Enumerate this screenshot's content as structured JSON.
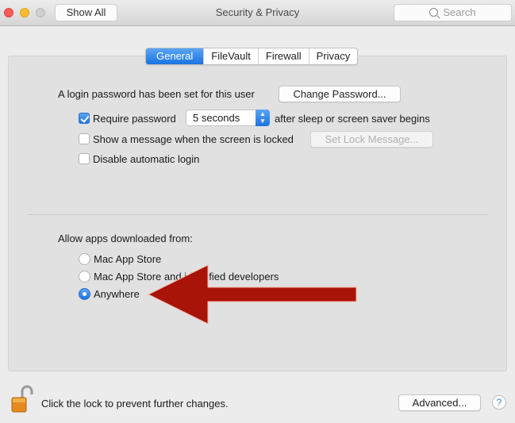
{
  "window": {
    "title": "Security & Privacy",
    "show_all_label": "Show All",
    "search_placeholder": "Search"
  },
  "tabs": [
    {
      "label": "General",
      "active": true
    },
    {
      "label": "FileVault",
      "active": false
    },
    {
      "label": "Firewall",
      "active": false
    },
    {
      "label": "Privacy",
      "active": false
    }
  ],
  "general": {
    "login_password_text": "A login password has been set for this user",
    "change_password_label": "Change Password...",
    "require_password": {
      "label": "Require password",
      "checked": true
    },
    "require_password_delay": "5 seconds",
    "after_sleep_text": "after sleep or screen saver begins",
    "show_message": {
      "label": "Show a message when the screen is locked",
      "checked": false
    },
    "set_lock_message_label": "Set Lock Message...",
    "disable_auto_login": {
      "label": "Disable automatic login",
      "checked": false
    }
  },
  "allow_apps": {
    "heading": "Allow apps downloaded from:",
    "options": [
      {
        "label": "Mac App Store",
        "selected": false
      },
      {
        "label": "Mac App Store and identified developers",
        "selected": false
      },
      {
        "label": "Anywhere",
        "selected": true
      }
    ]
  },
  "annotation": {
    "arrow_color": "#a81408",
    "points_to": "Anywhere"
  },
  "footer": {
    "lock_text": "Click the lock to prevent further changes.",
    "advanced_label": "Advanced...",
    "help_label": "?"
  },
  "colors": {
    "accent": "#1a73e0",
    "panel_bg": "#e1e1e1",
    "window_bg": "#ececec"
  }
}
